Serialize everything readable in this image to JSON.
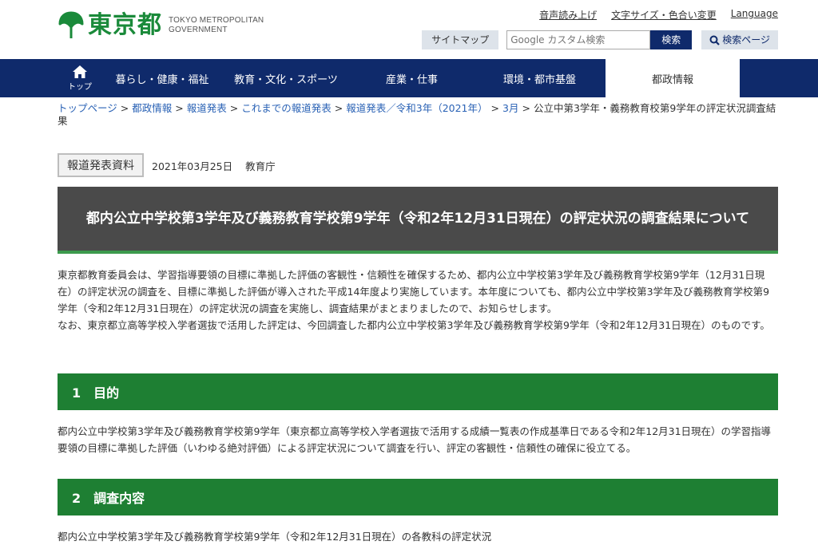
{
  "header": {
    "logo_jp": "東京都",
    "logo_en_line1": "TOKYO METROPOLITAN",
    "logo_en_line2": "GOVERNMENT",
    "util_links": [
      "音声読み上げ",
      "文字サイズ・色合い変更",
      "Language"
    ],
    "sitemap_label": "サイトマップ",
    "search_placeholder": "Google カスタム検索",
    "search_button": "検索",
    "search_page_label": "検索ページ"
  },
  "nav": {
    "home_label": "トップ",
    "items": [
      "暮らし・健康・福祉",
      "教育・文化・スポーツ",
      "産業・仕事",
      "環境・都市基盤",
      "都政情報"
    ]
  },
  "breadcrumb": {
    "links": [
      "トップページ",
      "都政情報",
      "報道発表",
      "これまでの報道発表",
      "報道発表／令和3年（2021年）",
      "3月"
    ],
    "current": "公立中第3学年・義務教育校第9学年の評定状況調査結果"
  },
  "press": {
    "badge": "報道発表資料",
    "date": "2021年03月25日",
    "department": "教育庁"
  },
  "title": "都内公立中学校第3学年及び義務教育学校第9学年（令和2年12月31日現在）の評定状況の調査結果について",
  "intro": {
    "p1": "東京都教育委員会は、学習指導要領の目標に準拠した評価の客観性・信頼性を確保するため、都内公立中学校第3学年及び義務教育学校第9学年（12月31日現在）の評定状況の調査を、目標に準拠した評価が導入された平成14年度より実施しています。本年度についても、都内公立中学校第3学年及び義務教育学校第9学年（令和2年12月31日現在）の評定状況の調査を実施し、調査結果がまとまりましたので、お知らせします。",
    "p2": "なお、東京都立高等学校入学者選抜で活用した評定は、今回調査した都内公立中学校第3学年及び義務教育学校第9学年（令和2年12月31日現在）のものです。"
  },
  "sections": [
    {
      "heading": "1　目的",
      "body": "都内公立中学校第3学年及び義務教育学校第9学年（東京都立高等学校入学者選抜で活用する成績一覧表の作成基準日である令和2年12月31日現在）の学習指導要領の目標に準拠した評価（いわゆる絶対評価）による評定状況について調査を行い、評定の客観性・信頼性の確保に役立てる。"
    },
    {
      "heading": "2　調査内容",
      "body": "都内公立中学校第3学年及び義務教育学校第9学年（令和2年12月31日現在）の各教科の評定状況"
    }
  ],
  "colors": {
    "nav_bg": "#0f2a6b",
    "section_bg": "#1e7f33",
    "title_bg": "#4a4a4a",
    "logo_green": "#1a8a3a",
    "link_blue": "#2a62b5"
  }
}
